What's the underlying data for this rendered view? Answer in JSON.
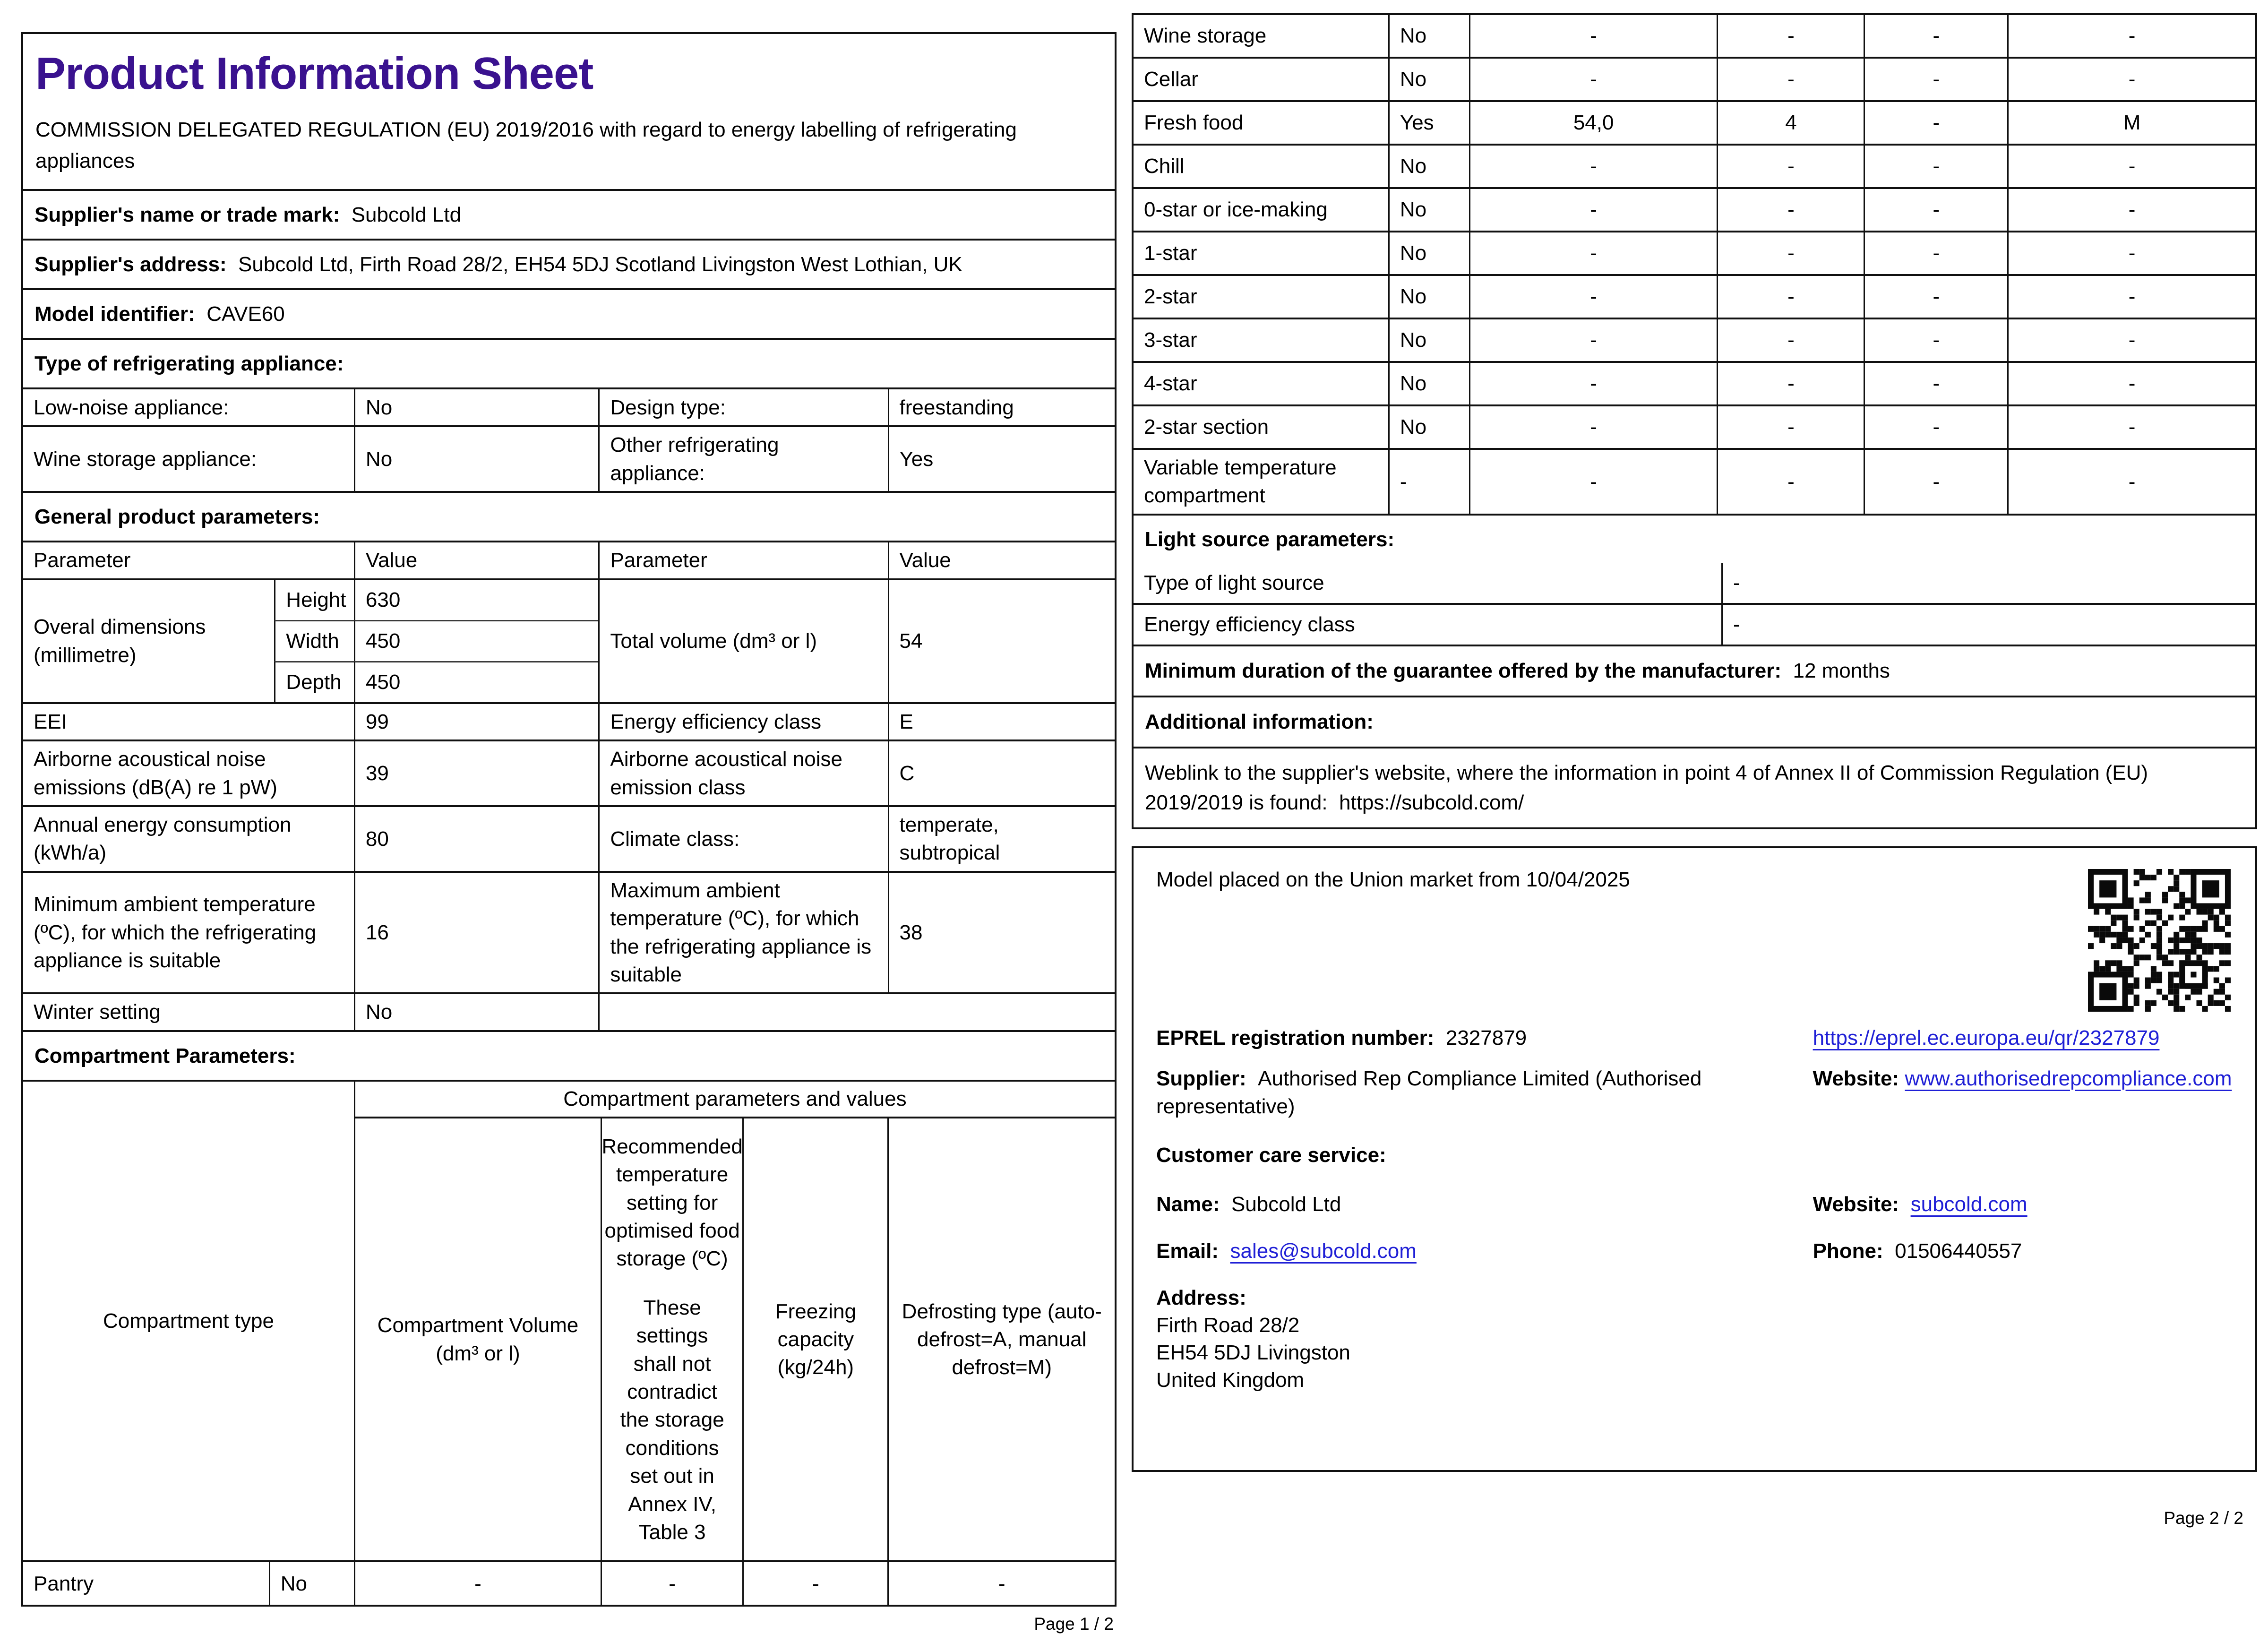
{
  "colors": {
    "title": "#3a128f",
    "link": "#1f1fd6"
  },
  "page1": {
    "title": "Product Information Sheet",
    "regulation": "COMMISSION DELEGATED REGULATION (EU) 2019/2016 with regard to energy labelling of refrigerating appliances",
    "supplier_name": {
      "label": "Supplier's name or trade mark:",
      "value": "Subcold Ltd"
    },
    "supplier_address": {
      "label": "Supplier's address:",
      "value": "Subcold Ltd, Firth Road 28/2, EH54 5DJ Scotland Livingston West Lothian, UK"
    },
    "model_identifier": {
      "label": "Model identifier:",
      "value": "CAVE60"
    },
    "type_heading": "Type of refrigerating appliance:",
    "type_table": {
      "low_noise_label": "Low-noise appliance:",
      "low_noise_value": "No",
      "design_label": "Design type:",
      "design_value": "freestanding",
      "wine_label": "Wine storage appliance:",
      "wine_value": "No",
      "other_label": "Other refrigerating appliance:",
      "other_value": "Yes"
    },
    "general_heading": "General product parameters:",
    "general_table": {
      "header": {
        "p1": "Parameter",
        "v1": "Value",
        "p2": "Parameter",
        "v2": "Value"
      },
      "dimensions": {
        "label": "Overal dimensions (millimetre)",
        "height_label": "Height",
        "height": "630",
        "width_label": "Width",
        "width": "450",
        "depth_label": "Depth",
        "depth": "450",
        "total_volume_label": "Total volume (dm³ or l)",
        "total_volume": "54"
      },
      "rows": [
        {
          "p1": "EEI",
          "v1": "99",
          "p2": "Energy efficiency class",
          "v2": "E"
        },
        {
          "p1": "Airborne acoustical noise emissions (dB(A) re 1 pW)",
          "v1": "39",
          "p2": "Airborne acoustical noise emission class",
          "v2": "C"
        },
        {
          "p1": "Annual energy consumption (kWh/a)",
          "v1": "80",
          "p2": "Climate class:",
          "v2": "temperate, subtropical"
        },
        {
          "p1": "Minimum ambient temperature (ºC), for which the refrigerating appliance is suitable",
          "v1": "16",
          "p2": "Maximum ambient temperature (ºC), for which the refrigerating appliance is suitable",
          "v2": "38"
        }
      ],
      "winter_label": "Winter setting",
      "winter_value": "No"
    },
    "compartment_heading": "Compartment Parameters:",
    "compartment_table": {
      "span_header": "Compartment parameters and values",
      "col_type": "Compartment type",
      "col_volume": "Compartment Volume (dm³ or l)",
      "col_temp_1": "Recommended temperature setting for optimised food storage (ºC)",
      "col_temp_2": "These settings shall not contradict the storage conditions set out in Annex IV, Table 3",
      "col_freezing": "Freezing capacity (kg/24h)",
      "col_defrost": "Defrosting type (auto-defrost=A, manual defrost=M)",
      "pantry": {
        "name": "Pantry",
        "present": "No",
        "volume": "-",
        "temp": "-",
        "freezing": "-",
        "defrost": "-"
      }
    },
    "footer": "Page 1 / 2"
  },
  "page2": {
    "compartments": [
      {
        "name": "Wine storage",
        "present": "No",
        "volume": "-",
        "temp": "-",
        "freezing": "-",
        "defrost": "-"
      },
      {
        "name": "Cellar",
        "present": "No",
        "volume": "-",
        "temp": "-",
        "freezing": "-",
        "defrost": "-"
      },
      {
        "name": "Fresh food",
        "present": "Yes",
        "volume": "54,0",
        "temp": "4",
        "freezing": "-",
        "defrost": "M"
      },
      {
        "name": "Chill",
        "present": "No",
        "volume": "-",
        "temp": "-",
        "freezing": "-",
        "defrost": "-"
      },
      {
        "name": "0-star or ice-making",
        "present": "No",
        "volume": "-",
        "temp": "-",
        "freezing": "-",
        "defrost": "-"
      },
      {
        "name": "1-star",
        "present": "No",
        "volume": "-",
        "temp": "-",
        "freezing": "-",
        "defrost": "-"
      },
      {
        "name": "2-star",
        "present": "No",
        "volume": "-",
        "temp": "-",
        "freezing": "-",
        "defrost": "-"
      },
      {
        "name": "3-star",
        "present": "No",
        "volume": "-",
        "temp": "-",
        "freezing": "-",
        "defrost": "-"
      },
      {
        "name": "4-star",
        "present": "No",
        "volume": "-",
        "temp": "-",
        "freezing": "-",
        "defrost": "-"
      },
      {
        "name": "2-star section",
        "present": "No",
        "volume": "-",
        "temp": "-",
        "freezing": "-",
        "defrost": "-"
      },
      {
        "name": "Variable temperature compartment",
        "present": "-",
        "volume": "-",
        "temp": "-",
        "freezing": "-",
        "defrost": "-"
      }
    ],
    "light_heading": "Light source parameters:",
    "light_rows": [
      {
        "label": "Type of light source",
        "value": "-"
      },
      {
        "label": "Energy efficiency class",
        "value": "-"
      }
    ],
    "guarantee_label": "Minimum duration of the guarantee offered by the manufacturer:",
    "guarantee_value": "12 months",
    "additional_heading": "Additional information:",
    "weblink_text": "Weblink to the supplier's website, where the information in point 4 of Annex II of Commission Regulation (EU) 2019/2019 is found:",
    "weblink_url": "https://subcold.com/",
    "market_text": "Model placed on the Union market from 10/04/2025",
    "eprel_label": "EPREL registration number:",
    "eprel_value": "2327879",
    "eprel_link": "https://eprel.ec.europa.eu/qr/2327879",
    "supplier_label": "Supplier:",
    "supplier_value": "Authorised Rep Compliance Limited (Authorised representative)",
    "supplier_site_label": "Website:",
    "supplier_site": "www.authorisedrepcompliance.com",
    "customer_care_heading": "Customer care service:",
    "care_name_label": "Name:",
    "care_name": "Subcold Ltd",
    "care_site_label": "Website:",
    "care_site": "subcold.com",
    "care_email_label": "Email:",
    "care_email": "sales@subcold.com",
    "care_phone_label": "Phone:",
    "care_phone": "01506440557",
    "address_label": "Address:",
    "address_lines": [
      "Firth Road 28/2",
      " EH54 5DJ Livingston",
      "United Kingdom"
    ],
    "footer": "Page 2 / 2"
  }
}
